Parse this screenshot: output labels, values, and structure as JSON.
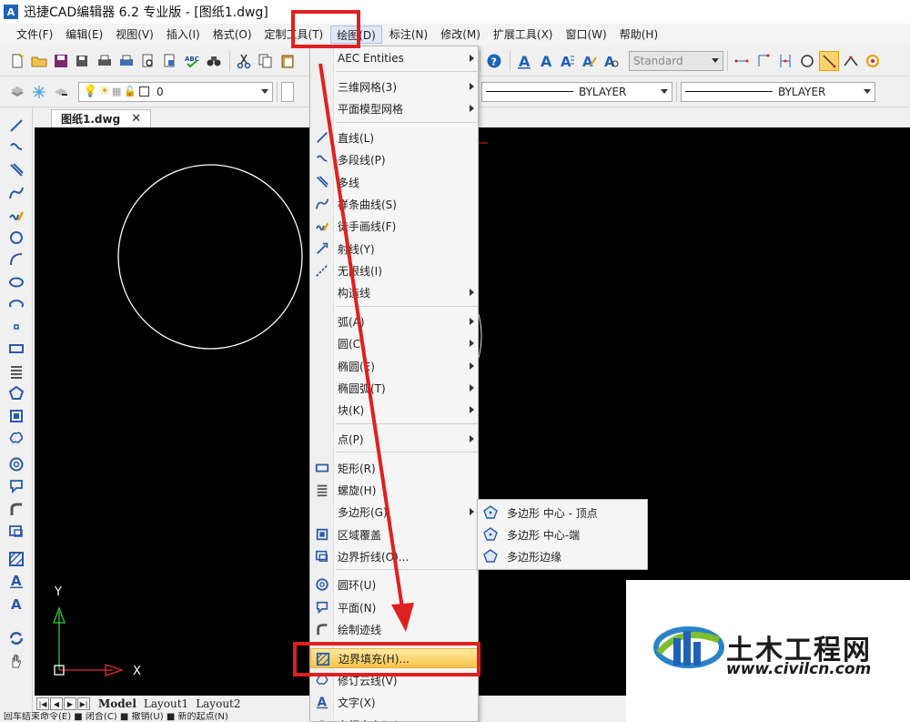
{
  "window": {
    "app_logo": "A",
    "title": "迅捷CAD编辑器 6.2 专业版 - [图纸1.dwg]"
  },
  "menubar": {
    "items": [
      "文件(F)",
      "编辑(E)",
      "视图(V)",
      "插入(I)",
      "格式(O)",
      "定制工具(T)",
      "绘图(D)",
      "标注(N)",
      "修改(M)",
      "扩展工具(X)",
      "窗口(W)",
      "帮助(H)"
    ],
    "active": "绘图(D)"
  },
  "toolbar": {
    "text_style": "Standard",
    "layer_name": "0",
    "linetype_1": "BYLAYER",
    "linetype_2": "BYLAYER"
  },
  "document": {
    "tab_label": "图纸1.dwg",
    "close_glyph": "✕"
  },
  "canvas": {
    "axis_y": "Y",
    "axis_x": "X",
    "background": "#000000"
  },
  "layout_tabs": {
    "nav": [
      "|◀",
      "◀",
      "▶",
      "▶|"
    ],
    "tabs": [
      "Model",
      "Layout1",
      "Layout2"
    ],
    "active": "Model"
  },
  "draw_menu": {
    "items": [
      {
        "label": "AEC Entities",
        "submenu": true,
        "icon": ""
      },
      {
        "label": "三维网格(3)",
        "submenu": true,
        "icon": ""
      },
      {
        "label": "平面模型网格",
        "submenu": true,
        "icon": ""
      },
      {
        "label": "直线(L)",
        "submenu": false,
        "icon": "line-icon"
      },
      {
        "label": "多段线(P)",
        "submenu": false,
        "icon": "polyline-icon"
      },
      {
        "label": "多线",
        "submenu": false,
        "icon": "multiline-icon"
      },
      {
        "label": "样条曲线(S)",
        "submenu": false,
        "icon": "spline-icon"
      },
      {
        "label": "徒手画线(F)",
        "submenu": false,
        "icon": "freehand-icon"
      },
      {
        "label": "射线(Y)",
        "submenu": false,
        "icon": "ray-icon"
      },
      {
        "label": "无限线(I)",
        "submenu": false,
        "icon": "xline-icon"
      },
      {
        "label": "构造线",
        "submenu": true,
        "icon": ""
      },
      {
        "label": "弧(A)",
        "submenu": true,
        "icon": ""
      },
      {
        "label": "圆(C)",
        "submenu": true,
        "icon": ""
      },
      {
        "label": "椭圆(E)",
        "submenu": true,
        "icon": ""
      },
      {
        "label": "椭圆弧(T)",
        "submenu": true,
        "icon": ""
      },
      {
        "label": "块(K)",
        "submenu": true,
        "icon": ""
      },
      {
        "label": "点(P)",
        "submenu": true,
        "icon": ""
      },
      {
        "label": "矩形(R)",
        "submenu": false,
        "icon": "rectangle-icon"
      },
      {
        "label": "螺旋(H)",
        "submenu": false,
        "icon": "helix-icon"
      },
      {
        "label": "多边形(G)",
        "submenu": true,
        "icon": ""
      },
      {
        "label": "区域覆盖",
        "submenu": false,
        "icon": "wipeout-icon"
      },
      {
        "label": "边界折线(O)...",
        "submenu": false,
        "icon": "boundary-icon"
      },
      {
        "label": "圆环(U)",
        "submenu": false,
        "icon": "donut-icon"
      },
      {
        "label": "平面(N)",
        "submenu": false,
        "icon": "plane-icon"
      },
      {
        "label": "绘制迹线",
        "submenu": false,
        "icon": "trace-icon"
      },
      {
        "label": "边界填充(H)...",
        "submenu": false,
        "icon": "hatch-icon"
      },
      {
        "label": "修订云线(V)",
        "submenu": false,
        "icon": "revcloud-icon"
      },
      {
        "label": "文字(X)",
        "submenu": false,
        "icon": "text-icon"
      },
      {
        "label": "多行文字(M)",
        "submenu": false,
        "icon": "mtext-icon"
      }
    ],
    "highlighted": "边界填充(H)..."
  },
  "polygon_submenu": {
    "items": [
      "多边形 中心 - 顶点",
      "多边形 中心-端",
      "多边形边缘"
    ]
  },
  "status": {
    "text": "回车结束命令(E)  ■ 闭合(C)  ■ 撤销(U)  ■ 新的起点(N)"
  },
  "watermark": {
    "title": "土木工程网",
    "url": "www.civilcn.com"
  },
  "colors": {
    "annotation_red": "#e02020",
    "highlight_gold": "#f7c44a",
    "icon_blue": "#2a5aa8"
  }
}
